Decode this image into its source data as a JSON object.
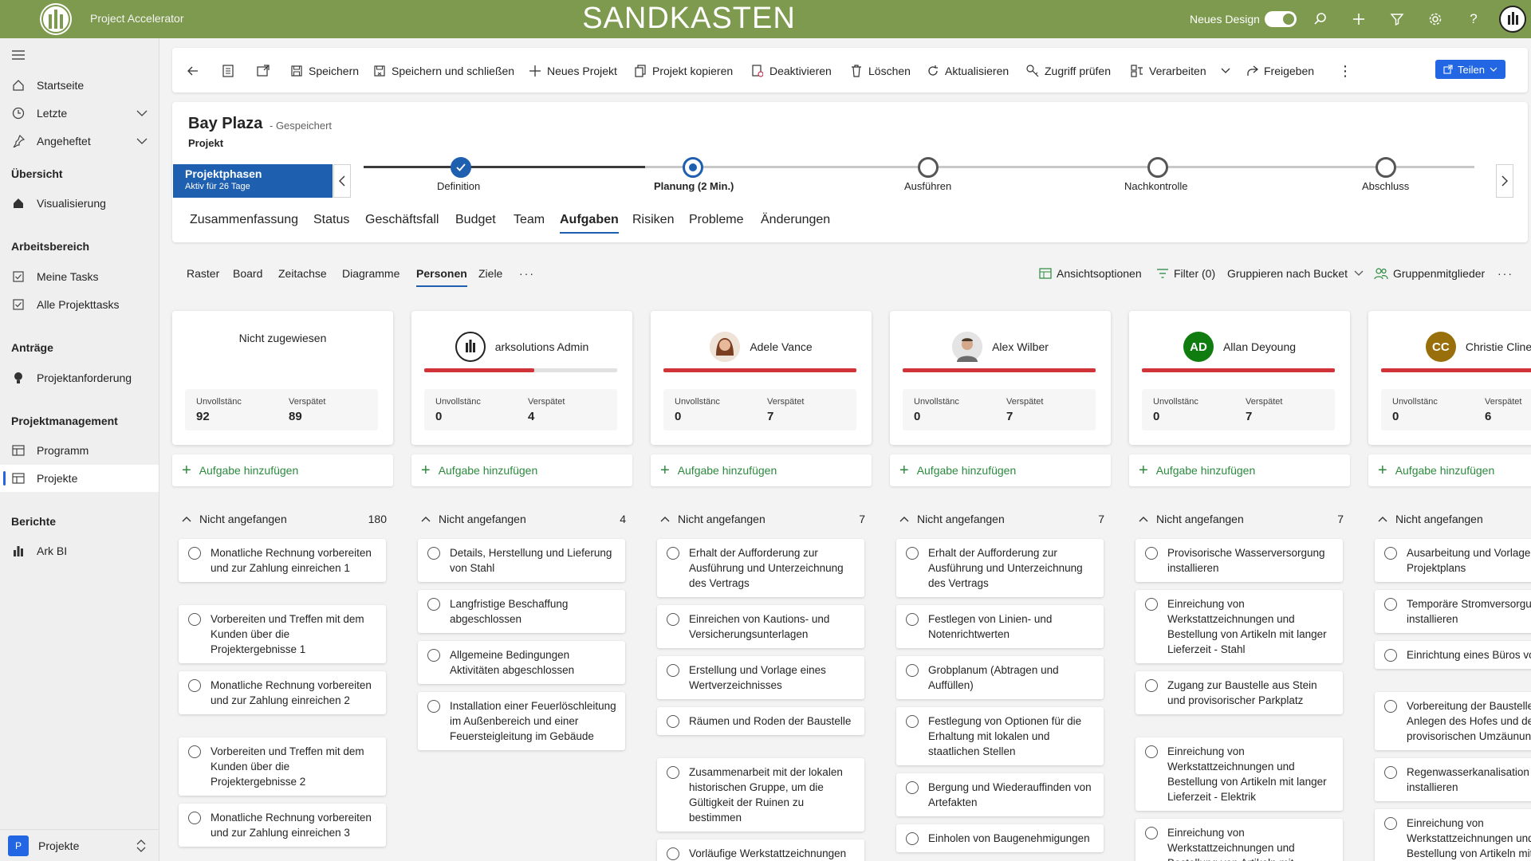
{
  "header": {
    "app_name": "Project Accelerator",
    "environment": "SANDKASTEN",
    "new_design_label": "Neues Design",
    "new_design_on": true,
    "brand_color": "#7d9a4e"
  },
  "sidebar": {
    "items_top": [
      {
        "label": "Startseite",
        "icon": "home-icon"
      },
      {
        "label": "Letzte",
        "icon": "clock-icon"
      },
      {
        "label": "Angeheftet",
        "icon": "pin-icon"
      }
    ],
    "sections": [
      {
        "title": "Übersicht",
        "items": [
          {
            "label": "Visualisierung",
            "icon": "home-icon"
          }
        ]
      },
      {
        "title": "Arbeitsbereich",
        "items": [
          {
            "label": "Meine Tasks",
            "icon": "checkbox-icon"
          },
          {
            "label": "Alle Projekttasks",
            "icon": "checkbox-icon"
          }
        ]
      },
      {
        "title": "Anträge",
        "items": [
          {
            "label": "Projektanforderung",
            "icon": "lightbulb-icon"
          }
        ]
      },
      {
        "title": "Projektmanagement",
        "items": [
          {
            "label": "Programm",
            "icon": "board-icon"
          },
          {
            "label": "Projekte",
            "icon": "board-icon"
          }
        ]
      },
      {
        "title": "Berichte",
        "items": [
          {
            "label": "Ark BI",
            "icon": "barchart-icon"
          }
        ]
      }
    ],
    "area_switcher": {
      "letter": "P",
      "label": "Projekte"
    }
  },
  "commands": {
    "save": "Speichern",
    "save_close": "Speichern und schließen",
    "new_project": "Neues Projekt",
    "copy_project": "Projekt kopieren",
    "deactivate": "Deaktivieren",
    "delete": "Löschen",
    "refresh": "Aktualisieren",
    "check_access": "Zugriff prüfen",
    "process": "Verarbeiten",
    "release": "Freigeben",
    "share": "Teilen"
  },
  "project": {
    "title": "Bay Plaza",
    "saved_state": "- Gespeichert",
    "type": "Projekt",
    "phase_box_title": "Projektphasen",
    "phase_box_sub": "Aktiv für 26 Tage",
    "stages": [
      "Definition",
      "Planung  (2 Min.)",
      "Ausführen",
      "Nachkontrolle",
      "Abschluss"
    ],
    "tabs": [
      "Zusammenfassung",
      "Status",
      "Geschäftsfall",
      "Budget",
      "Team",
      "Aufgaben",
      "Risiken",
      "Probleme",
      "Änderungen"
    ],
    "selected_tab": "Aufgaben"
  },
  "views": {
    "items": [
      "Raster",
      "Board",
      "Zeitachse",
      "Diagramme",
      "Personen",
      "Ziele"
    ],
    "selected": "Personen",
    "options": {
      "view_options": "Ansichtsoptionen",
      "filter": "Filter (0)",
      "group_by": "Gruppieren nach Bucket",
      "group_members": "Gruppenmitglieder"
    }
  },
  "board": {
    "incomplete_label": "Unvollstänc",
    "late_label": "Verspätet",
    "add_task_label": "Aufgabe hinzufügen",
    "bucket_label": "Nicht angefangen",
    "late_color": "#d13438",
    "people": [
      {
        "name": "Nicht zugewiesen",
        "avatar": "none",
        "incomplete": "92",
        "late": "89",
        "late_fraction": null,
        "bucket_count": "180",
        "tasks": [
          "Monatliche Rechnung vorbereiten und zur Zahlung einreichen 1",
          "Vorbereiten und Treffen mit dem Kunden über die Projektergebnisse 1",
          "Monatliche Rechnung vorbereiten und zur Zahlung einreichen 2",
          "Vorbereiten und Treffen mit dem Kunden über die Projektergebnisse 2",
          "Monatliche Rechnung vorbereiten und zur Zahlung einreichen 3"
        ]
      },
      {
        "name": "arksolutions Admin",
        "avatar": "logo",
        "incomplete": "0",
        "late": "4",
        "late_fraction": 0.57,
        "bucket_count": "4",
        "tasks": [
          "Details, Herstellung und Lieferung von Stahl",
          "Langfristige Beschaffung abgeschlossen",
          "Allgemeine Bedingungen Aktivitäten abgeschlossen",
          "Installation einer Feuerlöschleitung im Außenbereich und einer Feuersteigleitung im Gebäude"
        ]
      },
      {
        "name": "Adele Vance",
        "avatar": "photo-female",
        "incomplete": "0",
        "late": "7",
        "late_fraction": 1.0,
        "bucket_count": "7",
        "tasks": [
          "Erhalt der Aufforderung zur Ausführung und Unterzeichnung des Vertrags",
          "Einreichen von Kautions- und Versicherungsunterlagen",
          "Erstellung und Vorlage eines Wertverzeichnisses",
          "Räumen und Roden der Baustelle",
          "Zusammenarbeit mit der lokalen historischen Gruppe, um die Gültigkeit der Ruinen zu bestimmen",
          "Vorläufige Werkstattzeichnungen einreichen"
        ]
      },
      {
        "name": "Alex Wilber",
        "avatar": "photo-male",
        "incomplete": "0",
        "late": "7",
        "late_fraction": 1.0,
        "bucket_count": "7",
        "tasks": [
          "Erhalt der Aufforderung zur Ausführung und Unterzeichnung des Vertrags",
          "Festlegen von Linien- und Notenrichtwerten",
          "Grobplanum (Abtragen und Auffüllen)",
          "Festlegung von Optionen für die Erhaltung mit lokalen und staatlichen Stellen",
          "Bergung und Wiederauffinden von Artefakten",
          "Einholen von Baugenehmigungen"
        ]
      },
      {
        "name": "Allan Deyoung",
        "avatar": "AD",
        "avatar_color": "#107c10",
        "incomplete": "0",
        "late": "7",
        "late_fraction": 1.0,
        "bucket_count": "7",
        "tasks": [
          "Provisorische Wasserversorgung installieren",
          "Einreichung von Werkstattzeichnungen und Bestellung von Artikeln mit langer Lieferzeit - Stahl",
          "Zugang zur Baustelle aus Stein und provisorischer Parkplatz",
          "Einreichung von Werkstattzeichnungen und Bestellung von Artikeln mit langer Lieferzeit - Elektrik",
          "Einreichung von Werkstattzeichnungen und Bestellung von Artikeln mit"
        ]
      },
      {
        "name": "Christie Cline",
        "avatar": "CC",
        "avatar_color": "#986f0b",
        "incomplete": "0",
        "late": "6",
        "late_fraction": 1.0,
        "bucket_count": "",
        "tasks": [
          "Ausarbeitung und Vorlage des Projektplans",
          "Temporäre Stromversorgung installieren",
          "Einrichtung eines Büros vor Ort",
          "Vorbereitung der Baustelle - Anlegen des Hofes und des provisorischen Umzäunung",
          "Regenwasserkanalisation installieren",
          "Einreichung von Werkstattzeichnungen und Bestellung von Artikeln mit langem Vorlauf - Sanitär"
        ]
      }
    ]
  }
}
